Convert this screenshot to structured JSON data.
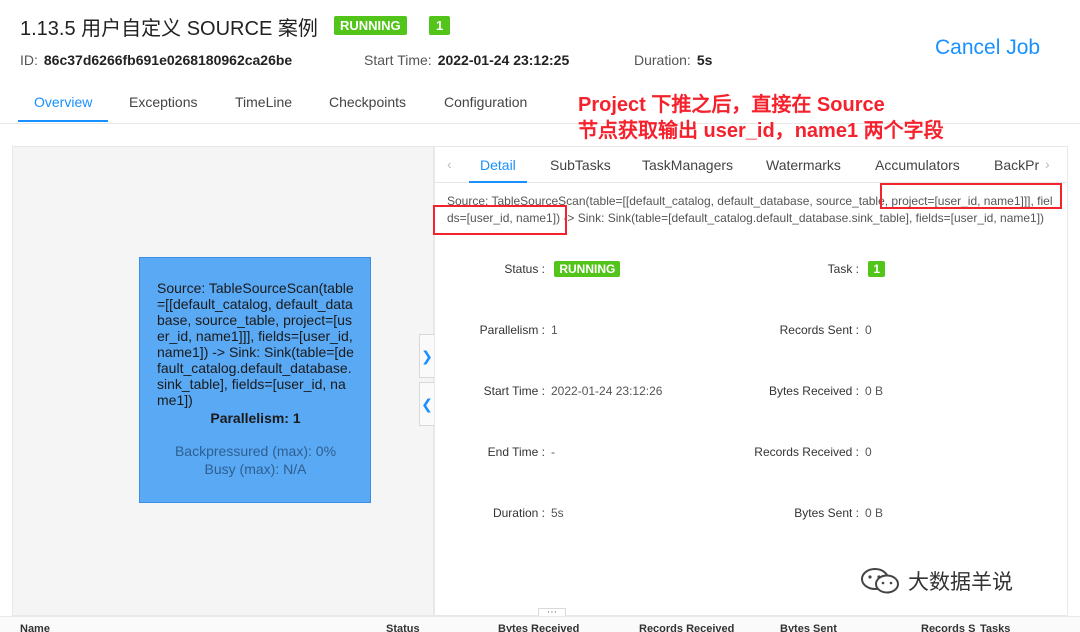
{
  "header": {
    "job_title": "1.13.5 用户自定义 SOURCE 案例",
    "status": "RUNNING",
    "task_count": "1",
    "id_label": "ID:",
    "id_value": "86c37d6266fb691e0268180962ca26be",
    "start_label": "Start Time:",
    "start_value": "2022-01-24 23:12:25",
    "duration_label": "Duration:",
    "duration_value": "5s",
    "cancel_label": "Cancel Job"
  },
  "tabs": [
    "Overview",
    "Exceptions",
    "TimeLine",
    "Checkpoints",
    "Configuration"
  ],
  "annotation": {
    "line1": "Project 下推之后，直接在 Source",
    "line2": "节点获取输出 user_id，name1 两个字段"
  },
  "node": {
    "text": "Source: TableSourceScan(table=[[default_catalog, default_database, source_table, project=[user_id, name1]]], fields=[user_id, name1]) -> Sink: Sink(table=[default_catalog.default_database.sink_table], fields=[user_id, name1])",
    "parallelism": "Parallelism: 1",
    "backpressured": "Backpressured (max): 0%",
    "busy": "Busy (max): N/A"
  },
  "detail": {
    "tabs": [
      "Detail",
      "SubTasks",
      "TaskManagers",
      "Watermarks",
      "Accumulators",
      "BackPr"
    ],
    "plan": "Source: TableSourceScan(table=[[default_catalog, default_database, source_table, project=[user_id, name1]]], fields=[user_id, name1]) -> Sink: Sink(table=[default_catalog.default_database.sink_table], fields=[user_id, name1])",
    "status_label": "Status :",
    "status_value": "RUNNING",
    "task_label": "Task :",
    "task_value": "1",
    "parallelism_label": "Parallelism :",
    "parallelism_value": "1",
    "records_sent_label": "Records Sent :",
    "records_sent_value": "0",
    "start_time_label": "Start Time :",
    "start_time_value": "2022-01-24 23:12:26",
    "bytes_received_label": "Bytes Received :",
    "bytes_received_value": "0 B",
    "end_time_label": "End Time :",
    "end_time_value": "-",
    "records_received_label": "Records Received :",
    "records_received_value": "0",
    "duration_label": "Duration :",
    "duration_value": "5s",
    "bytes_sent_label": "Bytes Sent :",
    "bytes_sent_value": "0 B"
  },
  "watermark": "大数据羊说",
  "collapse": "⋯",
  "bottom_columns": [
    "Name",
    "Status",
    "Bytes Received",
    "Records Received",
    "Bytes Sent",
    "Records S",
    "Tasks"
  ]
}
